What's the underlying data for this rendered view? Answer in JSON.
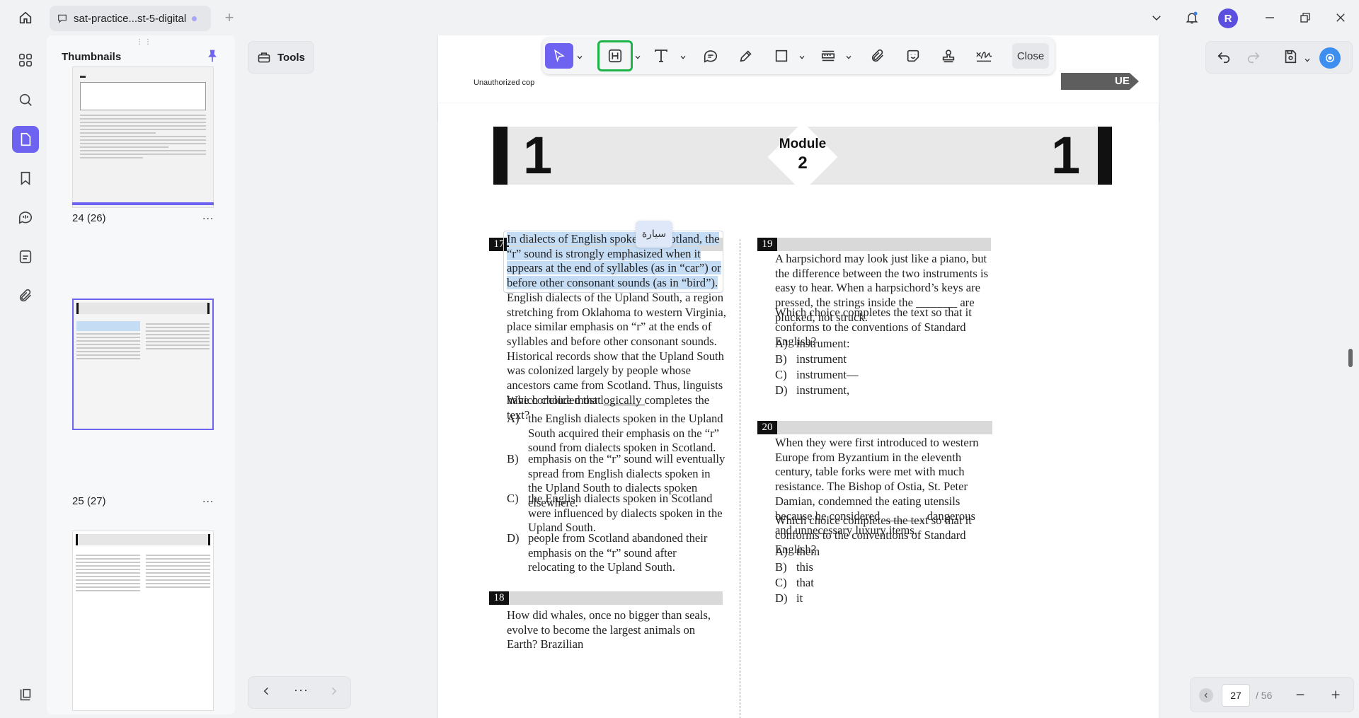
{
  "titlebar": {
    "tab_title": "sat-practice...st-5-digital",
    "add_tab": "+",
    "avatar_initial": "R"
  },
  "sidebar": {
    "title": "Thumbnails",
    "pages": [
      {
        "label": "24 (26)",
        "more": "..."
      },
      {
        "label": "25 (27)",
        "more": "..."
      },
      {
        "label": "",
        "more": ""
      }
    ]
  },
  "tools": {
    "label": "Tools"
  },
  "annot_toolbar": {
    "close_label": "Close",
    "icons": [
      "select-arrow-icon",
      "highlight-h-icon",
      "text-icon",
      "comment-icon",
      "pen-icon",
      "rectangle-icon",
      "measure-icon",
      "attachment-icon",
      "sticker-icon",
      "stamp-icon",
      "signature-icon"
    ]
  },
  "doc": {
    "prev_warning": "Unauthorized cop",
    "prev_arrow_text": "UE",
    "module": {
      "left_num": "1",
      "word": "Module",
      "num": "2",
      "right_num": "1"
    },
    "translation_popup": "سيارة",
    "q17": {
      "num": "17",
      "highlighted": "In dialects of English spoken in Scotland, the “r” sound is strongly emphasized when it appears at the end of syllables (as in “car”) or before other consonant sounds (as in “bird”).",
      "rest": " English dialects of the Upland South, a region stretching from Oklahoma to western Virginia, place similar emphasis on “r” at the ends of syllables and before other consonant sounds. Historical records show that the Upland South was colonized largely by people whose ancestors came from Scotland. Thus, linguists have concluded that _______",
      "prompt": "Which choice most logically completes the text?",
      "options": [
        {
          "letter": "A)",
          "text": "the English dialects spoken in the Upland South acquired their emphasis on the “r” sound from dialects spoken in Scotland."
        },
        {
          "letter": "B)",
          "text": "emphasis on the “r” sound will eventually spread from English dialects spoken in the Upland South to dialects spoken elsewhere."
        },
        {
          "letter": "C)",
          "text": "the English dialects spoken in Scotland were influenced by dialects spoken in the Upland South."
        },
        {
          "letter": "D)",
          "text": "people from Scotland abandoned their emphasis on the “r” sound after relocating to the Upland South."
        }
      ]
    },
    "q18": {
      "num": "18",
      "text": "How did whales, once no bigger than seals, evolve to become the largest animals on Earth? Brazilian"
    },
    "q19": {
      "num": "19",
      "text": "A harpsichord may look just like a piano, but the difference between the two instruments is easy to hear. When a harpsichord’s keys are pressed, the strings inside the _______ are plucked, not struck.",
      "prompt": "Which choice completes the text so that it conforms to the conventions of Standard English?",
      "options": [
        {
          "letter": "A)",
          "text": "instrument:"
        },
        {
          "letter": "B)",
          "text": "instrument"
        },
        {
          "letter": "C)",
          "text": "instrument—"
        },
        {
          "letter": "D)",
          "text": "instrument,"
        }
      ]
    },
    "q20": {
      "num": "20",
      "text": "When they were first introduced to western Europe from Byzantium in the eleventh century, table forks were met with much resistance. The Bishop of Ostia, St. Peter Damian, condemned the eating utensils because he considered _______ dangerous and unnecessary luxury items.",
      "prompt": "Which choice completes the text so that it conforms to the conventions of Standard English?",
      "options": [
        {
          "letter": "A)",
          "text": "them"
        },
        {
          "letter": "B)",
          "text": "this"
        },
        {
          "letter": "C)",
          "text": "that"
        },
        {
          "letter": "D)",
          "text": "it"
        }
      ]
    }
  },
  "pager": {
    "current": "27",
    "total": "/ 56"
  },
  "colors": {
    "accent": "#6d63f0",
    "highlight": "#c5dcf5",
    "focus_green": "#1db447"
  }
}
